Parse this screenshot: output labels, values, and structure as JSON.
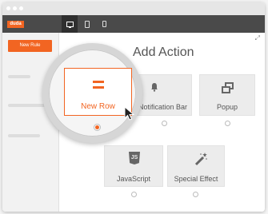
{
  "app": {
    "logo_text": "duda"
  },
  "toolbar": {
    "devices": [
      {
        "name": "desktop-icon",
        "active": true
      },
      {
        "name": "tablet-icon",
        "active": false
      },
      {
        "name": "mobile-icon",
        "active": false
      }
    ]
  },
  "sidebar": {
    "new_rule_label": "New Rule"
  },
  "main": {
    "title": "Add Action",
    "close_glyph": "⤢",
    "actions": [
      {
        "label": "New Row",
        "icon": "equals-icon",
        "selected": true
      },
      {
        "label": "Notification Bar",
        "icon": "bell-icon",
        "selected": false
      },
      {
        "label": "Popup",
        "icon": "popup-icon",
        "selected": false
      },
      {
        "label": "JavaScript",
        "icon": "javascript-icon",
        "selected": false
      },
      {
        "label": "Special Effect",
        "icon": "magic-wand-icon",
        "selected": false
      }
    ]
  },
  "colors": {
    "accent": "#f26522",
    "toolbar": "#4a4a4a",
    "card": "#ececec",
    "text": "#555555"
  }
}
